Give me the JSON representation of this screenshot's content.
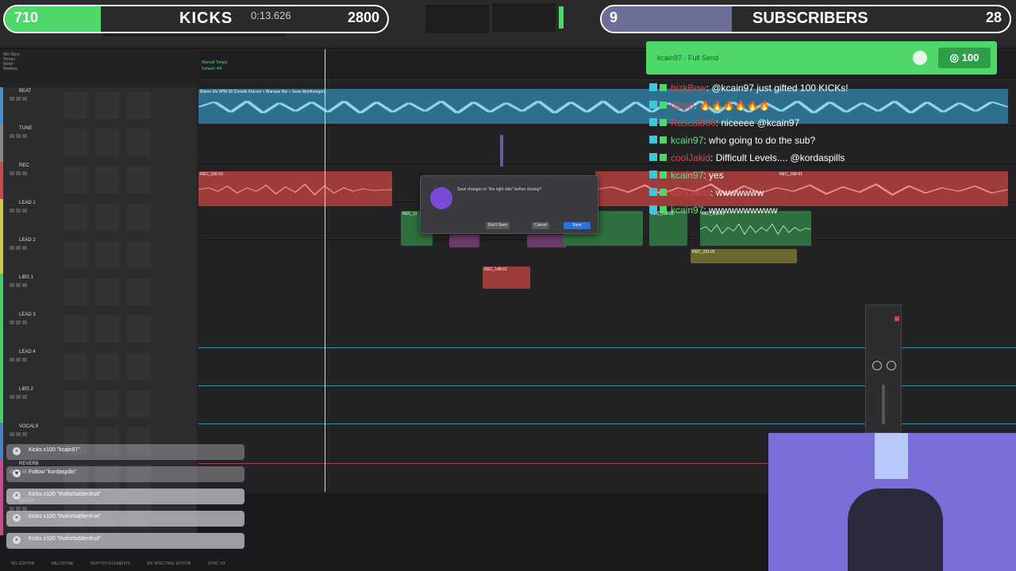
{
  "kicks_goal": {
    "count": "710",
    "title": "KICKS",
    "goal": "2800",
    "progress": 0.25
  },
  "subs_goal": {
    "count": "9",
    "title": "SUBSCRIBERS",
    "goal": "28",
    "progress": 0.32
  },
  "transport": {
    "counter": "0:13.626"
  },
  "tracks": [
    {
      "name": "BEAT",
      "color": "#4a8fc9"
    },
    {
      "name": "TUNE",
      "color": "#888888"
    },
    {
      "name": "REC",
      "color": "#c94a4a"
    },
    {
      "name": "LEAD 1",
      "color": "#c9c94a"
    },
    {
      "name": "LEAD 2",
      "color": "#c9c94a"
    },
    {
      "name": "LIBS 1",
      "color": "#4ac96a"
    },
    {
      "name": "LEAD 3",
      "color": "#4ac96a"
    },
    {
      "name": "LEAD 4",
      "color": "#4ac96a"
    },
    {
      "name": "LIBS 2",
      "color": "#4ac96a"
    },
    {
      "name": "VOCALS",
      "color": "#4a7fc9"
    },
    {
      "name": "REVERB",
      "color": "#c94a8f"
    },
    {
      "name": "DELAY",
      "color": "#c94a8f"
    }
  ],
  "beat_clip_label": "Blame Me 8PM 99 (Details Kidcool + Blanque Rai + Sean Monthanger)",
  "clips": {
    "rec_a": "REC_100-03",
    "rec_b": "REC_168-01",
    "lead2_a": "REC_11",
    "lead2_b": "REC_224-01",
    "lead2_c": "REC_168-01",
    "libs1_a": "REC_231-01",
    "lead3_a": "REC_148-01"
  },
  "dialog": {
    "message": "Save changes to \"the right vibe\" before closing?",
    "dont_save": "Don't Save",
    "cancel": "Cancel",
    "save": "Save"
  },
  "chat": {
    "header_user": "kcain97",
    "header_action": "Full Send",
    "coins": "100",
    "lines": [
      {
        "user": "bizkBow",
        "text": ": @kcain97 just gifted 100 KICKs!"
      },
      {
        "user": "02girl",
        "text": ": 🔥🔥🔥🔥🔥🔥"
      },
      {
        "user": "Rascal800",
        "text": ": niceeee @kcain97"
      },
      {
        "user": "kcain97",
        "text": ": who going to do the sub?"
      },
      {
        "user": "coolJakid",
        "text": ": Difficult Levels.... @kordaspills"
      },
      {
        "user": "kcain97",
        "text": ": yes"
      },
      {
        "user": "coolJakid",
        "text": ": wwwwwww"
      },
      {
        "user": "kcain97",
        "text": ": wwwwwwwwww"
      }
    ]
  },
  "alerts": [
    {
      "text": "Kicks x100 \"kcain97\"",
      "icon": "x"
    },
    {
      "text": "Follow \"kordaspills\"",
      "icon": "heart"
    },
    {
      "text": "Kicks x100 \"thaforbiddenfruit\"",
      "icon": "x"
    },
    {
      "text": "Kicks x100 \"thaforbiddenfruit\"",
      "icon": "x"
    },
    {
      "text": "Kicks x100 \"thaforbiddenfruit\"",
      "icon": "x"
    }
  ],
  "bottom_bar": {
    "items": [
      "NO. EDITOR",
      "MELODYNE",
      "REPITCH ELEMENTS",
      "RX SPECTRAL EDITOR",
      "SYNC VX"
    ]
  },
  "ruler": {
    "labels": [
      "Min:Secs",
      "Tempo",
      "Meter",
      "Markers"
    ],
    "tempo_marker": "Manual Tempo",
    "meter_marker": "Default: 4/4"
  }
}
